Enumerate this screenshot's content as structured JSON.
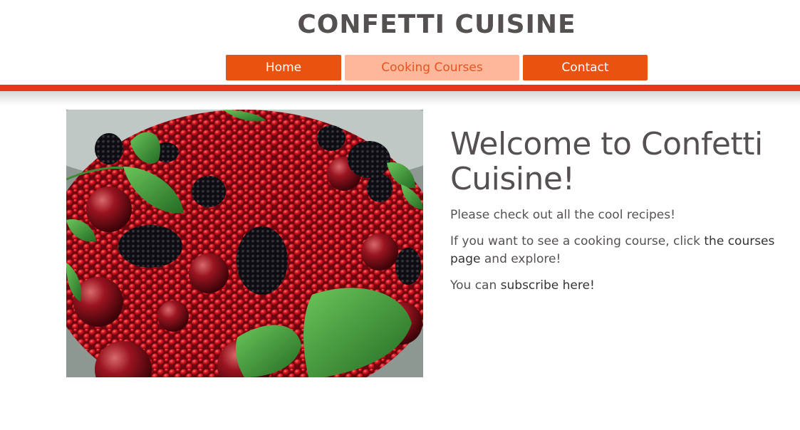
{
  "header": {
    "site_title": "CONFETTI CUISINE",
    "nav": {
      "home": "Home",
      "courses": "Cooking Courses",
      "contact": "Contact"
    }
  },
  "main": {
    "heading": "Welcome to Confetti Cuisine!",
    "para1": "Please check out all the cool recipes!",
    "para2_prefix": "If you want to see a cooking course, click ",
    "para2_link": "the courses page",
    "para2_suffix": " and explore!",
    "para3_prefix": "You can ",
    "para3_link": "subscribe here!"
  },
  "colors": {
    "brand_orange": "#e9530f",
    "active_tab_bg": "#fdb89b",
    "accent_bar": "#e8361b",
    "text": "#555150"
  }
}
